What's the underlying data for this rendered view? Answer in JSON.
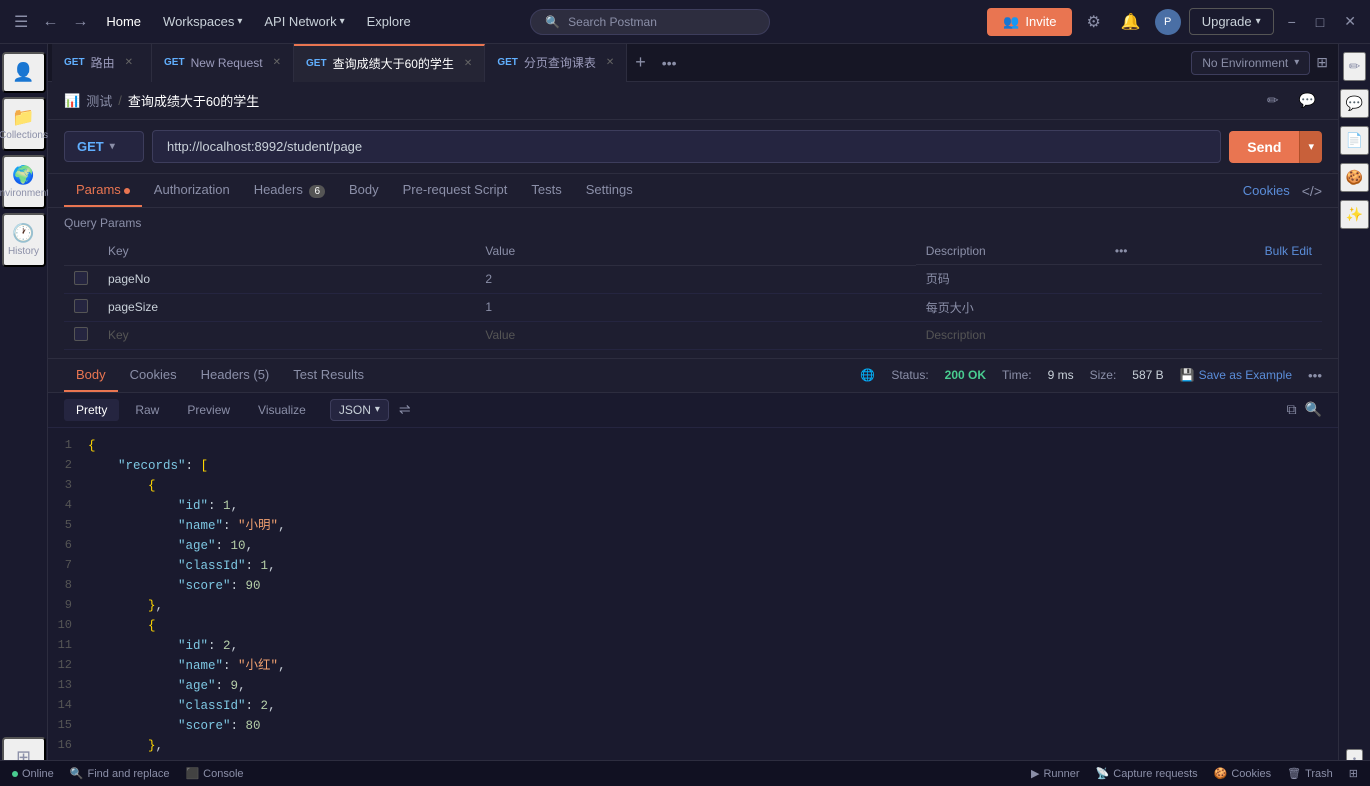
{
  "app": {
    "title": "Postman"
  },
  "topnav": {
    "home": "Home",
    "workspaces": "Workspaces",
    "api_network": "API Network",
    "explore": "Explore",
    "search_placeholder": "Search Postman",
    "invite_label": "Invite",
    "upgrade_label": "Upgrade",
    "no_environment": "No Environment"
  },
  "tabs": [
    {
      "method": "GET",
      "label": "路由",
      "active": false
    },
    {
      "method": "GET",
      "label": "New Request",
      "active": false
    },
    {
      "method": "GET",
      "label": "查询成绩大于60的学生",
      "active": true
    },
    {
      "method": "GET",
      "label": "分页查询课表",
      "active": false
    }
  ],
  "breadcrumb": {
    "icon": "📊",
    "parent": "测试",
    "separator": "/",
    "current": "查询成绩大于60的学生"
  },
  "request": {
    "method": "GET",
    "url": "http://localhost:8992/student/page",
    "send_label": "Send"
  },
  "request_tabs": [
    {
      "label": "Params",
      "has_dot": true,
      "active": true
    },
    {
      "label": "Authorization",
      "active": false
    },
    {
      "label": "Headers",
      "badge": "6",
      "active": false
    },
    {
      "label": "Body",
      "active": false
    },
    {
      "label": "Pre-request Script",
      "active": false
    },
    {
      "label": "Tests",
      "active": false
    },
    {
      "label": "Settings",
      "active": false
    }
  ],
  "cookies_link": "Cookies",
  "query_params": {
    "title": "Query Params",
    "columns": [
      "Key",
      "Value",
      "Description"
    ],
    "bulk_edit": "Bulk Edit",
    "rows": [
      {
        "checked": false,
        "key": "pageNo",
        "value": "2",
        "description": "页码"
      },
      {
        "checked": false,
        "key": "pageSize",
        "value": "1",
        "description": "每页大小"
      }
    ],
    "empty_row": {
      "key": "Key",
      "value": "Value",
      "description": "Description"
    }
  },
  "response": {
    "tabs": [
      "Body",
      "Cookies",
      "Headers (5)",
      "Test Results"
    ],
    "active_tab": "Body",
    "status": "200 OK",
    "time": "9 ms",
    "size": "587 B",
    "save_example": "Save as Example"
  },
  "code_tabs": [
    "Pretty",
    "Raw",
    "Preview",
    "Visualize"
  ],
  "code_format": "JSON",
  "code_lines": [
    {
      "num": 1,
      "content": "{"
    },
    {
      "num": 2,
      "content": "    \"records\": ["
    },
    {
      "num": 3,
      "content": "        {"
    },
    {
      "num": 4,
      "content": "            \"id\": 1,"
    },
    {
      "num": 5,
      "content": "            \"name\": \"小明\","
    },
    {
      "num": 6,
      "content": "            \"age\": 10,"
    },
    {
      "num": 7,
      "content": "            \"classId\": 1,"
    },
    {
      "num": 8,
      "content": "            \"score\": 90"
    },
    {
      "num": 9,
      "content": "        },"
    },
    {
      "num": 10,
      "content": "        {"
    },
    {
      "num": 11,
      "content": "            \"id\": 2,"
    },
    {
      "num": 12,
      "content": "            \"name\": \"小红\","
    },
    {
      "num": 13,
      "content": "            \"age\": 9,"
    },
    {
      "num": 14,
      "content": "            \"classId\": 2,"
    },
    {
      "num": 15,
      "content": "            \"score\": 80"
    },
    {
      "num": 16,
      "content": "        },"
    }
  ],
  "status_bar": {
    "online": "Online",
    "find_replace": "Find and replace",
    "console": "Console",
    "runner": "Runner",
    "capture": "Capture requests",
    "cookies": "Cookies",
    "trash": "Trash"
  },
  "sidebar": {
    "items": [
      {
        "icon": "☰",
        "label": ""
      },
      {
        "icon": "👤",
        "label": ""
      },
      {
        "icon": "📁",
        "label": "Collections"
      },
      {
        "icon": "🌍",
        "label": "Environments"
      },
      {
        "icon": "🕐",
        "label": "History"
      },
      {
        "icon": "⊞",
        "label": ""
      }
    ]
  }
}
